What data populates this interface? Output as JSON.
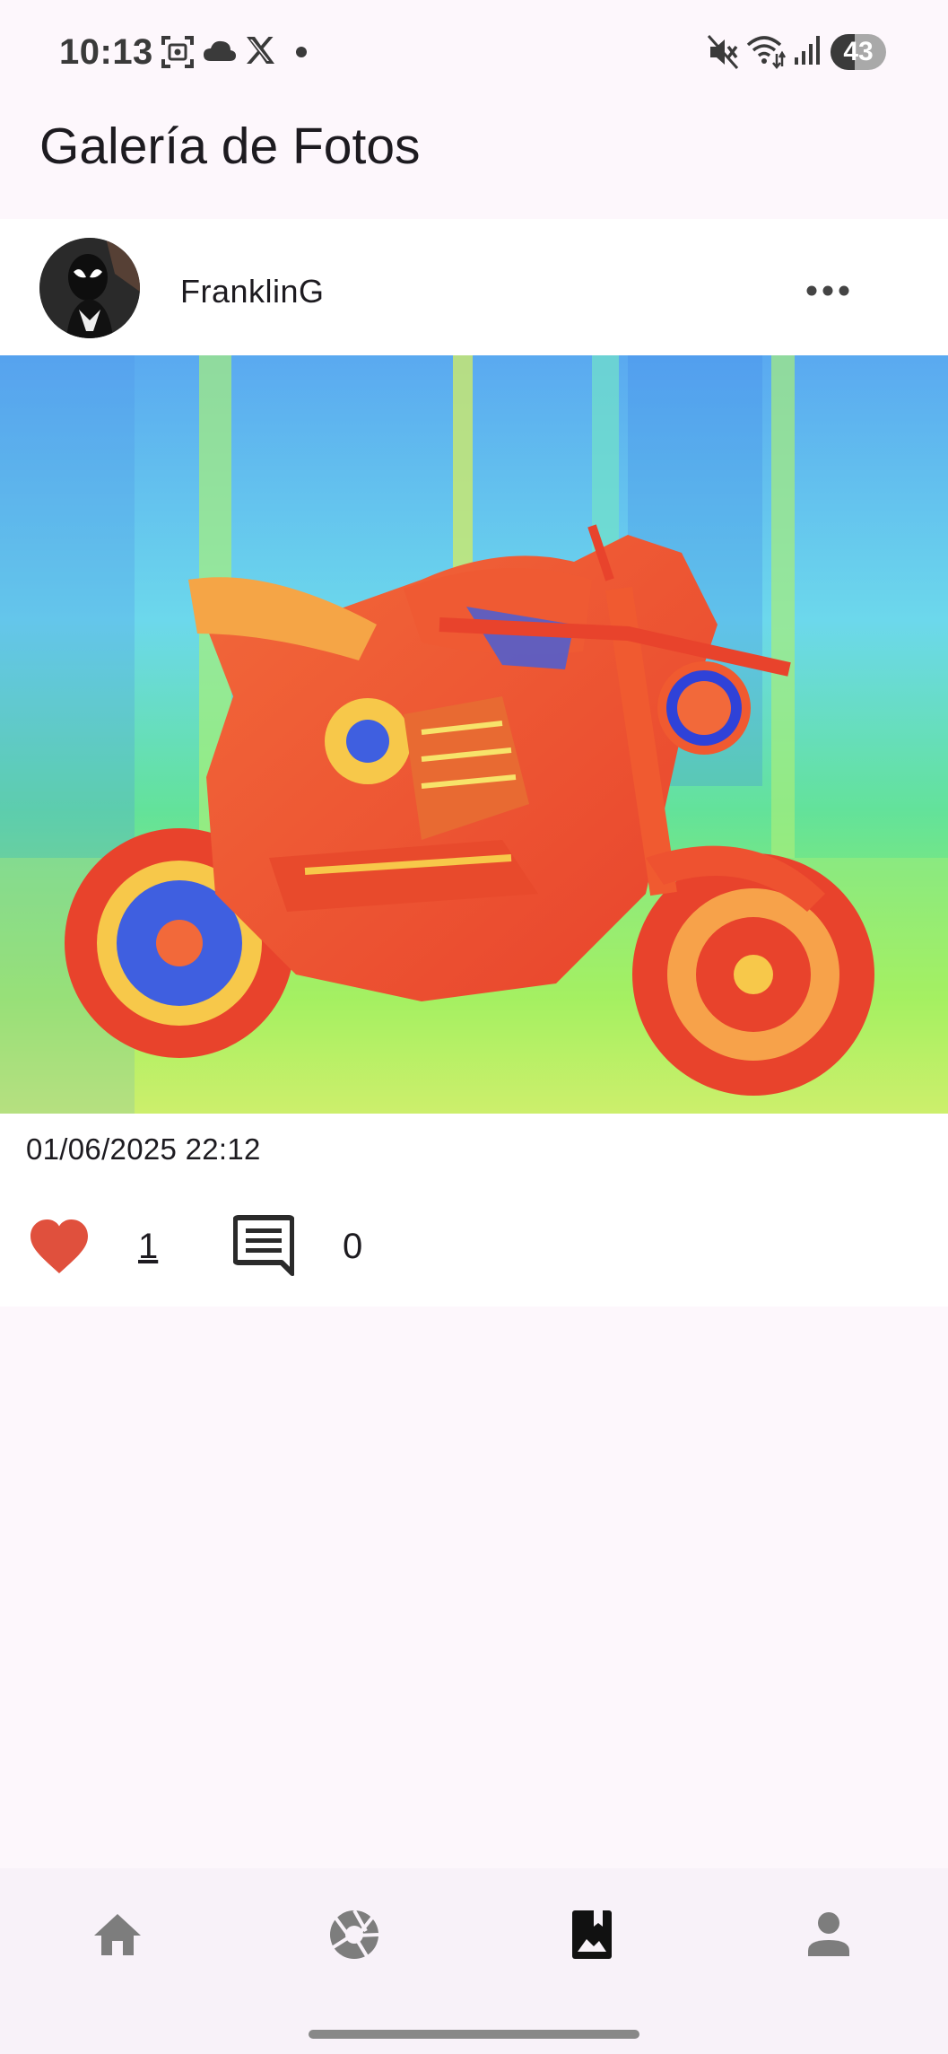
{
  "status_bar": {
    "time": "10:13",
    "battery": "43",
    "battery_level": 0.43,
    "left_icons": [
      "screenshot-icon",
      "cloud-icon",
      "x-logo-icon",
      "dot-icon"
    ],
    "right_icons": [
      "mute-icon",
      "wifi-icon",
      "signal-icon",
      "battery-icon"
    ]
  },
  "app_bar": {
    "title": "Galería de Fotos"
  },
  "post": {
    "username": "FranklinG",
    "date": "01/06/2025 22:12",
    "likes": "1",
    "comments": "0",
    "like_color": "#e0503d",
    "image_icon": "motorcycle-photo"
  },
  "bottom_nav": {
    "items": [
      {
        "icon": "home-icon",
        "selected": false
      },
      {
        "icon": "camera-aperture-icon",
        "selected": false
      },
      {
        "icon": "photo-bookmark-icon",
        "selected": true
      },
      {
        "icon": "person-icon",
        "selected": false
      }
    ]
  }
}
